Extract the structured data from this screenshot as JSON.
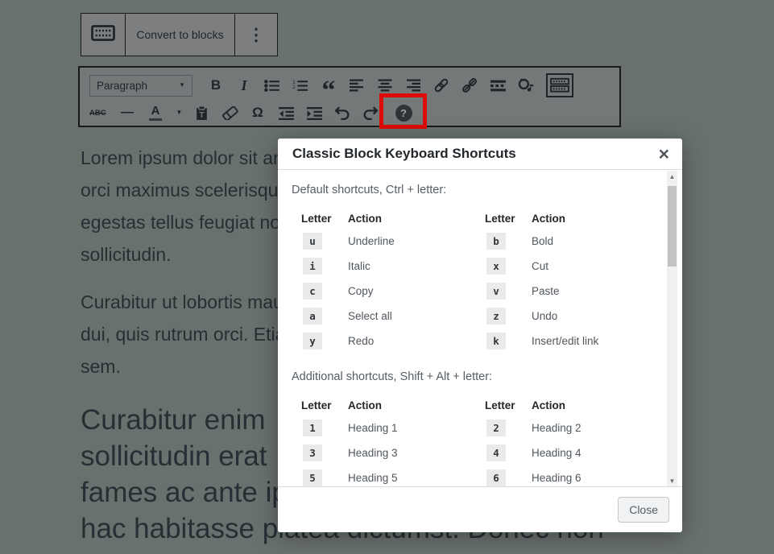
{
  "colors": {
    "page_bg": "#69716e",
    "toolbar_bg": "#7c7e80",
    "toolbar_bg2": "#747879",
    "toolbar_border": "#17191b",
    "icon_ink": "#1f2428",
    "doc_ink": "#272e34",
    "red": "#de0b0b",
    "modal_title": "#23282d",
    "muted": "#555d66",
    "action_ink": "#50575e",
    "badge_bg": "#eaeaea",
    "badge_ink": "#32373c"
  },
  "top_toolbar": {
    "convert_label": "Convert to blocks",
    "menu_glyph": "⋮"
  },
  "format_toolbar": {
    "paragraph_select_value": "Paragraph",
    "caret_glyph": "▼",
    "bold_glyph": "B",
    "italic_glyph": "I",
    "quote_glyph": "“",
    "strikethrough_glyph": "ABC",
    "hrule_glyph": "—",
    "text_color_glyph": "A",
    "omega_glyph": "Ω",
    "help_glyph": "?"
  },
  "document": {
    "paragraph1_lines": [
      "Lorem ipsum dolor sit an",
      "orci maximus scelerisque",
      "egestas tellus feugiat no",
      "sollicitudin."
    ],
    "paragraph2_lines": [
      "Curabitur ut lobortis mau",
      "dui, quis rutrum orci. Etia",
      "sem."
    ],
    "large_text_lines": [
      "Curabitur enim",
      "sollicitudin erat",
      "fames ac ante ip",
      "hac habitasse platea dictumst. Donec non"
    ]
  },
  "modal": {
    "title": "Classic Block Keyboard Shortcuts",
    "close_glyph": "×",
    "scroll_up_glyph": "▲",
    "scroll_down_glyph": "▼",
    "sections": [
      {
        "label": "Default shortcuts, Ctrl + letter:",
        "col_headers": [
          "Letter",
          "Action"
        ],
        "rows": [
          {
            "left": {
              "key": "u",
              "action": "Underline"
            },
            "right": {
              "key": "b",
              "action": "Bold"
            }
          },
          {
            "left": {
              "key": "i",
              "action": "Italic"
            },
            "right": {
              "key": "x",
              "action": "Cut"
            }
          },
          {
            "left": {
              "key": "c",
              "action": "Copy"
            },
            "right": {
              "key": "v",
              "action": "Paste"
            }
          },
          {
            "left": {
              "key": "a",
              "action": "Select all"
            },
            "right": {
              "key": "z",
              "action": "Undo"
            }
          },
          {
            "left": {
              "key": "y",
              "action": "Redo"
            },
            "right": {
              "key": "k",
              "action": "Insert/edit link"
            }
          }
        ]
      },
      {
        "label": "Additional shortcuts, Shift + Alt + letter:",
        "col_headers": [
          "Letter",
          "Action"
        ],
        "rows": [
          {
            "left": {
              "key": "1",
              "action": "Heading 1"
            },
            "right": {
              "key": "2",
              "action": "Heading 2"
            }
          },
          {
            "left": {
              "key": "3",
              "action": "Heading 3"
            },
            "right": {
              "key": "4",
              "action": "Heading 4"
            }
          },
          {
            "left": {
              "key": "5",
              "action": "Heading 5"
            },
            "right": {
              "key": "6",
              "action": "Heading 6"
            }
          }
        ]
      }
    ],
    "footer": {
      "close_label": "Close"
    }
  }
}
